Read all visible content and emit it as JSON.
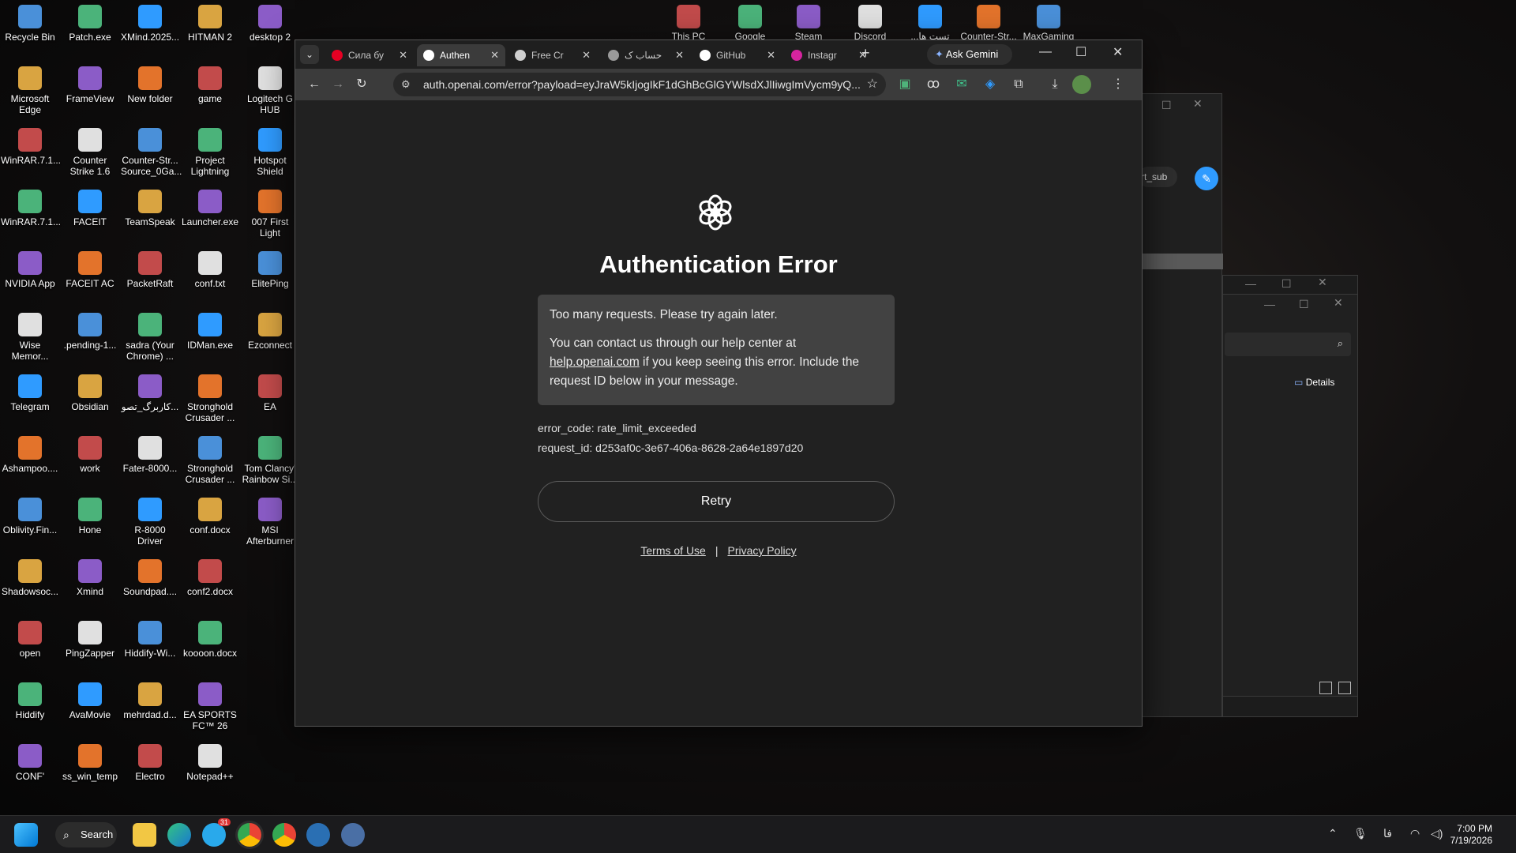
{
  "desktop": {
    "columns": [
      [
        "Recycle Bin",
        "Microsoft Edge",
        "WinRAR.7.1...",
        "WinRAR.7.1...",
        "NVIDIA App",
        "Wise Memor...",
        "Telegram",
        "Ashampoo....",
        "Oblivity.Fin...",
        "Shadowsoc...",
        "open",
        "Hiddify",
        "CONF'"
      ],
      [
        "Patch.exe",
        "FrameView",
        "Counter Strike 1.6",
        "FACEIT",
        "FACEIT AC",
        ".pending-1...",
        "Obsidian",
        "work",
        "Hone",
        "Xmind",
        "PingZapper",
        "AvaMovie",
        "ss_win_temp"
      ],
      [
        "XMind.2025...",
        "New folder",
        "Counter-Str... Source_0Ga...",
        "TeamSpeak",
        "PacketRaft",
        "sadra (Your Chrome) ...",
        "کاربرگ_تصو...",
        "Fater-8000...",
        "R-8000 Driver",
        "Soundpad....",
        "Hiddify-Wi...",
        "mehrdad.d...",
        "Electro"
      ],
      [
        "HITMAN 2",
        "game",
        "Project Lightning",
        "Launcher.exe",
        "conf.txt",
        "IDMan.exe",
        "Stronghold Crusader ...",
        "Stronghold Crusader ...",
        "conf.docx",
        "conf2.docx",
        "koooon.docx",
        "EA SPORTS FC™ 26",
        "Notepad++"
      ],
      [
        "desktop 2",
        "Logitech G HUB",
        "Hotspot Shield",
        "007 First Light",
        "ElitePing",
        "Ezconnect",
        "EA",
        "Tom Clancy' Rainbow Si...",
        "MSI Afterburner"
      ]
    ],
    "top_row": [
      "This PC",
      "Google",
      "Steam",
      "Discord",
      "...تست ها",
      "Counter-Str...",
      "MaxGaming"
    ]
  },
  "bg_windows": {
    "partial_text": "rt_sub",
    "details_label": "Details"
  },
  "browser": {
    "tabs": [
      {
        "title": "Сила бу",
        "icon": "pinterest-icon",
        "color": "#e60023"
      },
      {
        "title": "Authen",
        "icon": "openai-icon",
        "color": "#ffffff",
        "active": true
      },
      {
        "title": "Free Cr",
        "icon": "cursor-icon",
        "color": "#cfcfcf"
      },
      {
        "title": "حساب ک",
        "icon": "site-icon",
        "color": "#9a9a9a"
      },
      {
        "title": "GitHub",
        "icon": "github-icon",
        "color": "#ffffff"
      },
      {
        "title": "Instagr",
        "icon": "instagram-icon",
        "color": "#d6249f"
      }
    ],
    "ask_gemini": "Ask Gemini",
    "url": "auth.openai.com/error?payload=eyJraW5kIjogIkF1dGhBcGlGYWlsdXJlIiwgImVycm9yQ..."
  },
  "page": {
    "title": "Authentication Error",
    "message1": "Too many requests. Please try again later.",
    "message2_pre": "You can contact us through our help center at ",
    "help_link": "help.openai.com",
    "message2_post": " if you keep seeing this error. Include the request ID below in your message.",
    "error_code": "error_code: rate_limit_exceeded",
    "request_id": "request_id: d253af0c-3e67-406a-8628-2a64e1897d20",
    "retry_label": "Retry",
    "terms_label": "Terms of Use",
    "privacy_label": "Privacy Policy"
  },
  "taskbar": {
    "search_label": "Search",
    "lang": "فا",
    "time": "7:00 PM",
    "date": "7/19/2026",
    "telegram_badge": "31"
  },
  "colors": {
    "accent_blue": "#2f9bff",
    "page_bg": "#212121",
    "error_box": "#424242"
  }
}
